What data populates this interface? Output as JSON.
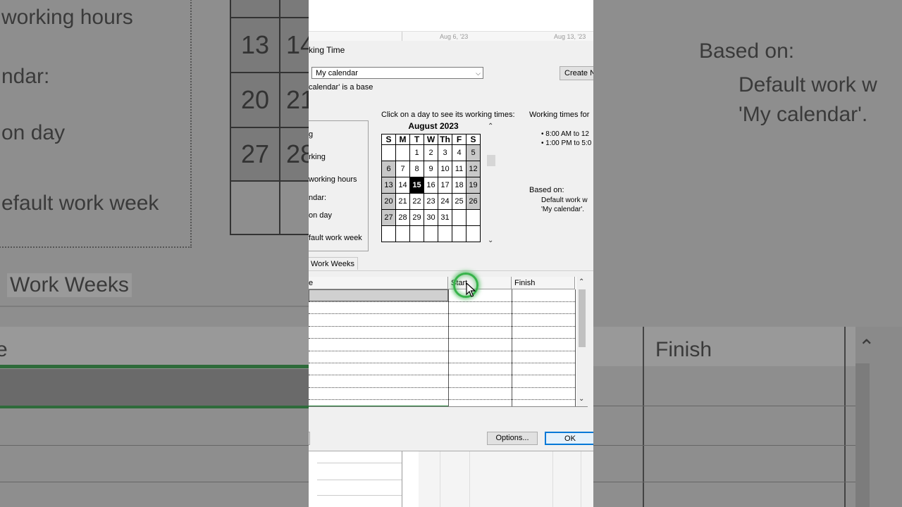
{
  "background_left": {
    "lines": [
      "working hours",
      "ndar:",
      "on day",
      "efault work week"
    ],
    "tab": "Work Weeks",
    "header_fragment": "e",
    "cal_numbers": [
      "13",
      "14",
      "20",
      "21",
      "27",
      "28"
    ]
  },
  "background_right": {
    "based_on_label": "Based on:",
    "based_on_line1": "Default work w",
    "based_on_line2": "'My calendar'.",
    "finish_header": "Finish",
    "scroll_up": "⌃"
  },
  "timescale": {
    "date1": "Aug 6, '23",
    "date2": "Aug 13, '23"
  },
  "dialog": {
    "title": "king Time",
    "calendar_select": "My calendar",
    "create_button": "Create N",
    "base_note": "calendar' is a base",
    "legend_items": [
      "g",
      "rking",
      "working hours",
      "ndar:",
      "on day",
      "fault work week"
    ],
    "click_day_prompt": "Click on a day to see its working times:",
    "working_times_for": "Working times for",
    "times": [
      "• 8:00 AM to 12",
      "• 1:00 PM to 5:0"
    ],
    "based_on_label": "Based on:",
    "based_on_line1": "Default work w",
    "based_on_line2": "'My calendar'.",
    "calendar": {
      "month": "August 2023",
      "days_header": [
        "S",
        "M",
        "T",
        "W",
        "Th",
        "F",
        "S"
      ],
      "weeks": [
        [
          "",
          "",
          "1",
          "2",
          "3",
          "4",
          "5"
        ],
        [
          "6",
          "7",
          "8",
          "9",
          "10",
          "11",
          "12"
        ],
        [
          "13",
          "14",
          "15",
          "16",
          "17",
          "18",
          "19"
        ],
        [
          "20",
          "21",
          "22",
          "23",
          "24",
          "25",
          "26"
        ],
        [
          "27",
          "28",
          "29",
          "30",
          "31",
          "",
          ""
        ],
        [
          "",
          "",
          "",
          "",
          "",
          "",
          ""
        ]
      ],
      "selected_day": "15"
    },
    "tab_label": "Work Weeks",
    "table": {
      "col_name": "e",
      "col_start": "Start",
      "col_finish": "Finish"
    },
    "options_button": "Options...",
    "ok_button": "OK"
  },
  "colors": {
    "accent": "#0078d7",
    "click_ring": "#37b34a",
    "header_bar": "#1e7b33"
  }
}
